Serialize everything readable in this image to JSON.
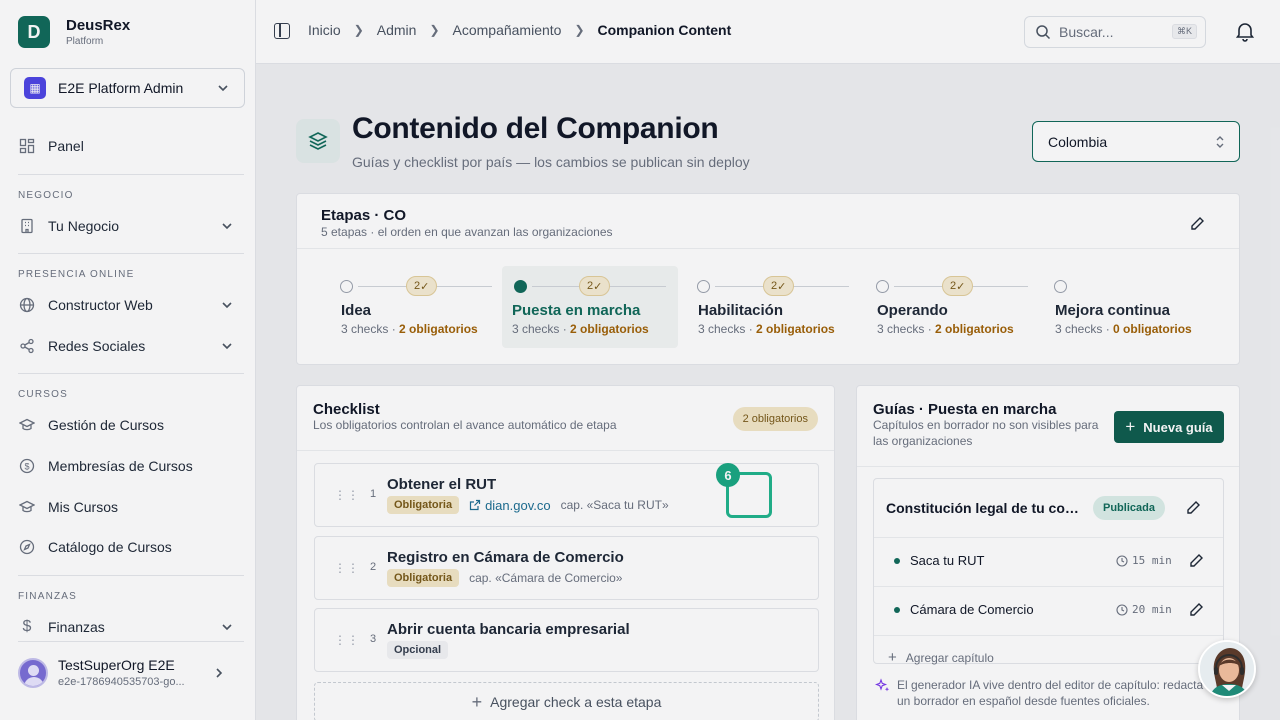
{
  "brand": {
    "name": "DeusRex",
    "subtitle": "Platform",
    "logo_letter": "D"
  },
  "org_switcher": {
    "label": "E2E Platform Admin"
  },
  "sidebar": {
    "panel": "Panel",
    "sections": [
      {
        "title": "NEGOCIO",
        "items": [
          "Tu Negocio"
        ]
      },
      {
        "title": "PRESENCIA ONLINE",
        "items": [
          "Constructor Web",
          "Redes Sociales"
        ]
      },
      {
        "title": "CURSOS",
        "items": [
          "Gestión de Cursos",
          "Membresías de Cursos",
          "Mis Cursos",
          "Catálogo de Cursos"
        ]
      },
      {
        "title": "FINANZAS",
        "items": [
          "Finanzas"
        ]
      }
    ]
  },
  "user": {
    "name": "TestSuperOrg E2E",
    "email": "e2e-1786940535703-go..."
  },
  "breadcrumb": [
    "Inicio",
    "Admin",
    "Acompañamiento",
    "Companion Content"
  ],
  "search": {
    "placeholder": "Buscar...",
    "shortcut": "⌘K"
  },
  "page": {
    "title": "Contenido del Companion",
    "subtitle": "Guías y checklist por país — los cambios se publican sin deploy",
    "country": "Colombia"
  },
  "stages": {
    "title": "Etapas · CO",
    "subtitle": "5 etapas · el orden en que avanzan las organizaciones",
    "items": [
      {
        "name": "Idea",
        "checks": "3 checks",
        "required": "2 obligatorios",
        "badge": "2"
      },
      {
        "name": "Puesta en marcha",
        "checks": "3 checks",
        "required": "2 obligatorios",
        "badge": "2"
      },
      {
        "name": "Habilitación",
        "checks": "3 checks",
        "required": "2 obligatorios",
        "badge": "2"
      },
      {
        "name": "Operando",
        "checks": "3 checks",
        "required": "2 obligatorios",
        "badge": "2"
      },
      {
        "name": "Mejora continua",
        "checks": "3 checks",
        "required": "0 obligatorios"
      }
    ],
    "active_index": 1
  },
  "checklist": {
    "title": "Checklist",
    "subtitle": "Los obligatorios controlan el avance automático de etapa",
    "badge": "2 obligatorios",
    "items": [
      {
        "num": "1",
        "title": "Obtener el RUT",
        "tag": "Obligatoria",
        "link": "dian.gov.co",
        "cap": "cap. «Saca tu RUT»"
      },
      {
        "num": "2",
        "title": "Registro en Cámara de Comercio",
        "tag": "Obligatoria",
        "cap": "cap. «Cámara de Comercio»"
      },
      {
        "num": "3",
        "title": "Abrir cuenta bancaria empresarial",
        "tag": "Opcional"
      }
    ],
    "add_label": "Agregar check a esta etapa",
    "marker_number": "6"
  },
  "guides": {
    "title": "Guías · Puesta en marcha",
    "subtitle_line1": "Capítulos en borrador no son visibles para",
    "subtitle_line2": "las organizaciones",
    "new_button": "Nueva guía",
    "guide_title": "Constitución legal de tu cons...",
    "status": "Publicada",
    "chapters": [
      {
        "name": "Saca tu RUT",
        "time": "15 min"
      },
      {
        "name": "Cámara de Comercio",
        "time": "20 min"
      }
    ],
    "add_chapter": "Agregar capítulo",
    "ai_note_line1": "El generador IA vive dentro del editor de capítulo: redacta",
    "ai_note_line2": "un borrador en español desde fuentes oficiales."
  },
  "colors": {
    "accent": "#116b5b",
    "warning_text": "#a16207",
    "marker": "#21b58d"
  }
}
